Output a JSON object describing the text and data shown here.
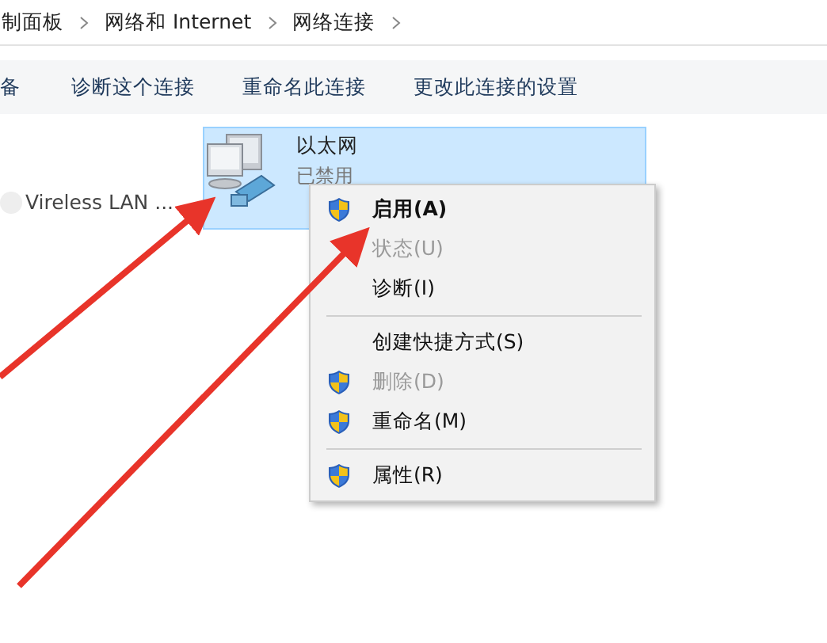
{
  "breadcrumb": [
    {
      "label": "制面板"
    },
    {
      "label": "网络和 Internet"
    },
    {
      "label": "网络连接"
    }
  ],
  "toolbar": [
    "备",
    "诊断这个连接",
    "重命名此连接",
    "更改此连接的设置"
  ],
  "connections": [
    {
      "name": "Vireless LAN ...",
      "selected": false
    },
    {
      "name": "以太网",
      "status": "已禁用",
      "selected": true
    }
  ],
  "context_menu": {
    "items": [
      {
        "kind": "item",
        "label": "启用(A)",
        "shield": true,
        "default": true,
        "disabled": false
      },
      {
        "kind": "item",
        "label": "状态(U)",
        "shield": false,
        "default": false,
        "disabled": true
      },
      {
        "kind": "item",
        "label": "诊断(I)",
        "shield": false,
        "default": false,
        "disabled": false
      },
      {
        "kind": "separator"
      },
      {
        "kind": "item",
        "label": "创建快捷方式(S)",
        "shield": false,
        "default": false,
        "disabled": false
      },
      {
        "kind": "item",
        "label": "删除(D)",
        "shield": true,
        "default": false,
        "disabled": true
      },
      {
        "kind": "item",
        "label": "重命名(M)",
        "shield": true,
        "default": false,
        "disabled": false
      },
      {
        "kind": "separator"
      },
      {
        "kind": "item",
        "label": "属性(R)",
        "shield": true,
        "default": false,
        "disabled": false
      }
    ]
  }
}
